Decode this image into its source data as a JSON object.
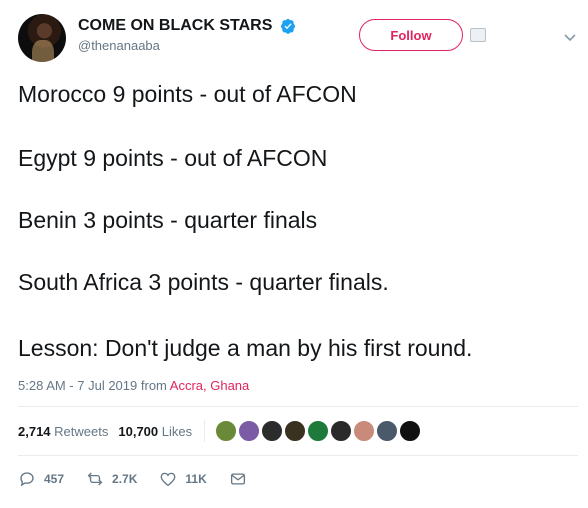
{
  "user": {
    "display_name": "COME ON BLACK STARS",
    "handle": "@thenanaaba",
    "follow_label": "Follow"
  },
  "tweet": {
    "lines": [
      "Morocco 9 points - out of AFCON",
      "Egypt 9 points - out of AFCON",
      "Benin 3 points - quarter finals",
      "South Africa 3 points - quarter finals.",
      "Lesson: Don't judge a man by his first round."
    ],
    "time_date": "5:28 AM - 7 Jul 2019",
    "from_label": "from",
    "location": "Accra, Ghana"
  },
  "stats": {
    "retweets_count": "2,714",
    "retweets_label": "Retweets",
    "likes_count": "10,700",
    "likes_label": "Likes"
  },
  "actions": {
    "reply_count": "457",
    "retweet_count": "2.7K",
    "like_count": "11K"
  },
  "colors": {
    "accent": "#e0245e",
    "verified": "#1da1f2",
    "muted": "#657786"
  },
  "likers": [
    {
      "name": "liker-avatar-1",
      "color": "#6a8a3a"
    },
    {
      "name": "liker-avatar-2",
      "color": "#7b5aa6"
    },
    {
      "name": "liker-avatar-3",
      "color": "#2c2c2c"
    },
    {
      "name": "liker-avatar-4",
      "color": "#3a3220"
    },
    {
      "name": "liker-avatar-5",
      "color": "#1e7a3a"
    },
    {
      "name": "liker-avatar-6",
      "color": "#2a2a2a"
    },
    {
      "name": "liker-avatar-7",
      "color": "#c98a7a"
    },
    {
      "name": "liker-avatar-8",
      "color": "#4a5a6a"
    },
    {
      "name": "liker-avatar-9",
      "color": "#111111"
    }
  ]
}
